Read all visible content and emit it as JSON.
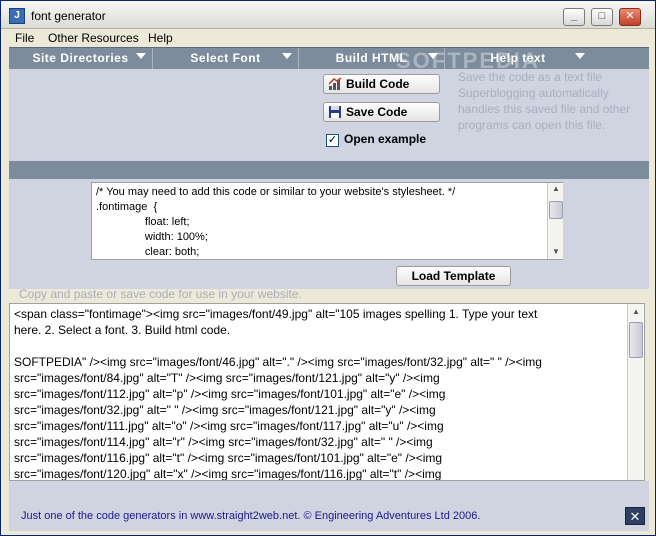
{
  "window": {
    "title": "font generator",
    "app_icon": "java-cup-icon"
  },
  "menubar": {
    "items": [
      "File",
      "Other Resources",
      "Help"
    ]
  },
  "tabs": [
    {
      "label": "Site Directories"
    },
    {
      "label": "Select Font"
    },
    {
      "label": "Build HTML"
    },
    {
      "label": "Help text"
    }
  ],
  "watermark": "SOFTPEDIA",
  "actions": {
    "build_label": "Build Code",
    "save_label": "Save Code",
    "open_example_label": "Open example",
    "open_example_checked": true,
    "load_template_label": "Load Template"
  },
  "help": {
    "title": "Save the code as a text file",
    "body": "Superblogging automatically handles this saved file and other programs can open this file."
  },
  "css_box": {
    "text": "/* You may need to add this code or similar to your website's stylesheet. */\n.fontimage  {\n\t\tfloat: left;\n\t\twidth: 100%;\n\t\tclear: both;"
  },
  "copy_hint": "Copy and paste or save code for use in your website.",
  "code": {
    "lines": [
      "<span class=\"fontimage\"><img src=\"images/font/49.jpg\"    alt=\"105 images spelling 1. Type your text",
      "here. 2. Select a font. 3. Build html code.",
      "",
      "SOFTPEDIA\" /><img src=\"images/font/46.jpg\"    alt=\".\" /><img src=\"images/font/32.jpg\"    alt=\" \" /><img",
      "src=\"images/font/84.jpg\"    alt=\"T\" /><img src=\"images/font/121.jpg\"    alt=\"y\" /><img",
      "src=\"images/font/112.jpg\"    alt=\"p\" /><img src=\"images/font/101.jpg\"    alt=\"e\" /><img",
      "src=\"images/font/32.jpg\"    alt=\" \" /><img src=\"images/font/121.jpg\"    alt=\"y\" /><img",
      "src=\"images/font/111.jpg\"    alt=\"o\" /><img src=\"images/font/117.jpg\"    alt=\"u\" /><img",
      "src=\"images/font/114.jpg\"    alt=\"r\" /><img src=\"images/font/32.jpg\"    alt=\" \" /><img",
      "src=\"images/font/116.jpg\"    alt=\"t\" /><img src=\"images/font/101.jpg\"    alt=\"e\" /><img",
      "src=\"images/font/120.jpg\"    alt=\"x\" /><img src=\"images/font/116.jpg\"    alt=\"t\" /><img"
    ]
  },
  "footer": {
    "text": "Just one of the code generators in www.straight2web.net. ©  Engineering Adventures Ltd 2006."
  },
  "colors": {
    "band": "#7c8c9c",
    "panel": "#d0d3e0",
    "hint": "#a9aebf",
    "footer_text": "#1b1b8a"
  }
}
